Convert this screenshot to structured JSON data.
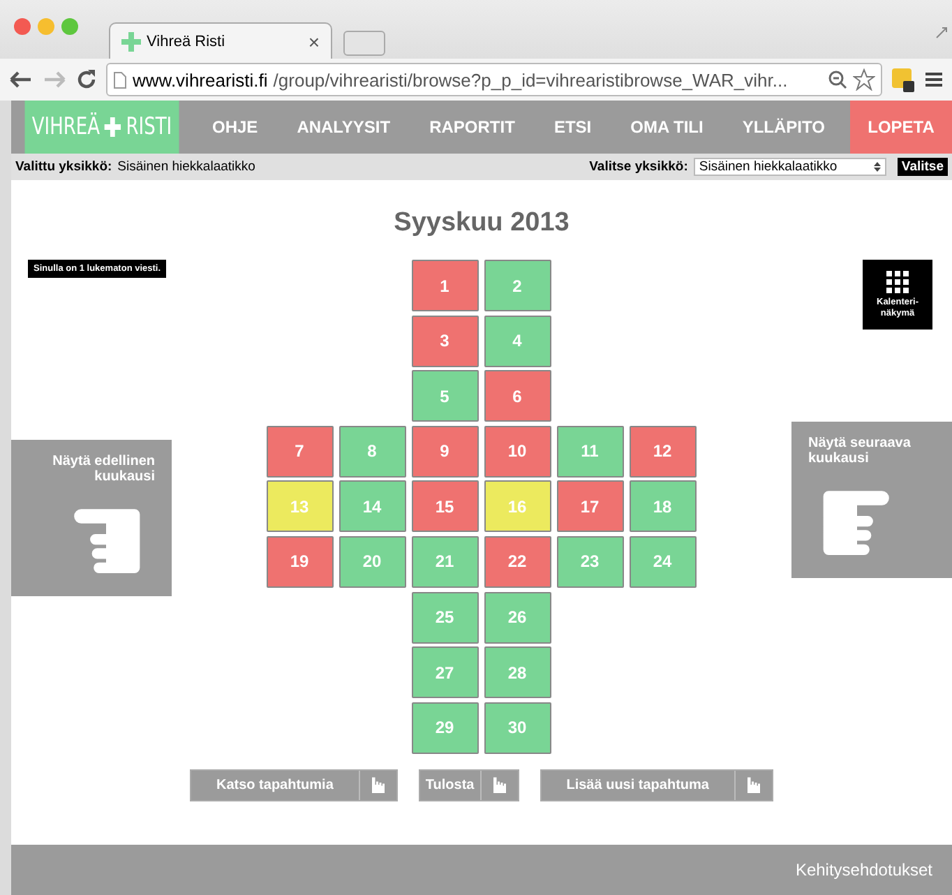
{
  "browser": {
    "tab_title": "Vihreä Risti",
    "tab_close": "×",
    "url_host": "www.vihrearisti.fi",
    "url_path": "/group/vihrearisti/browse?p_p_id=vihrearistibrowse_WAR_vihr..."
  },
  "nav": {
    "logo_left": "VIHREÄ",
    "logo_right": "RISTI",
    "items": [
      {
        "label": "OHJE"
      },
      {
        "label": "ANALYYSIT"
      },
      {
        "label": "RAPORTIT"
      },
      {
        "label": "ETSI"
      },
      {
        "label": "OMA TILI"
      },
      {
        "label": "YLLÄPITO"
      }
    ],
    "logout": "LOPETA"
  },
  "unit_bar": {
    "current_label": "Valittu yksikkö:",
    "current_value": "Sisäinen hiekkalaatikko",
    "select_label": "Valitse yksikkö:",
    "select_value": "Sisäinen hiekkalaatikko",
    "select_button": "Valitse"
  },
  "calendar": {
    "title": "Syyskuu 2013",
    "message": "Sinulla on 1 lukematon viesti.",
    "view_button": "Kalenteri-näkymä",
    "prev": "Näytä edellinen kuukausi",
    "next": "Näytä seuraava kuukausi",
    "days": [
      {
        "label": "1",
        "color": "#ef7270"
      },
      {
        "label": "2",
        "color": "#79d595"
      },
      {
        "label": "3",
        "color": "#ef7270"
      },
      {
        "label": "4",
        "color": "#79d595"
      },
      {
        "label": "5",
        "color": "#79d595"
      },
      {
        "label": "6",
        "color": "#ef7270"
      },
      {
        "label": "7",
        "color": "#ef7270"
      },
      {
        "label": "8",
        "color": "#79d595"
      },
      {
        "label": "9",
        "color": "#ef7270"
      },
      {
        "label": "10",
        "color": "#ef7270"
      },
      {
        "label": "11",
        "color": "#79d595"
      },
      {
        "label": "12",
        "color": "#ef7270"
      },
      {
        "label": "13",
        "color": "#ecea5e"
      },
      {
        "label": "14",
        "color": "#79d595"
      },
      {
        "label": "15",
        "color": "#ef7270"
      },
      {
        "label": "16",
        "color": "#ecea5e"
      },
      {
        "label": "17",
        "color": "#ef7270"
      },
      {
        "label": "18",
        "color": "#79d595"
      },
      {
        "label": "19",
        "color": "#ef7270"
      },
      {
        "label": "20",
        "color": "#79d595"
      },
      {
        "label": "21",
        "color": "#79d595"
      },
      {
        "label": "22",
        "color": "#ef7270"
      },
      {
        "label": "23",
        "color": "#79d595"
      },
      {
        "label": "24",
        "color": "#79d595"
      },
      {
        "label": "25",
        "color": "#79d595"
      },
      {
        "label": "26",
        "color": "#79d595"
      },
      {
        "label": "27",
        "color": "#79d595"
      },
      {
        "label": "28",
        "color": "#79d595"
      },
      {
        "label": "29",
        "color": "#79d595"
      },
      {
        "label": "30",
        "color": "#79d595"
      }
    ]
  },
  "actions": [
    {
      "label": "Katso tapahtumia"
    },
    {
      "label": "Tulosta"
    },
    {
      "label": "Lisää uusi tapahtuma"
    }
  ],
  "footer": {
    "link": "Kehitysehdotukset"
  }
}
